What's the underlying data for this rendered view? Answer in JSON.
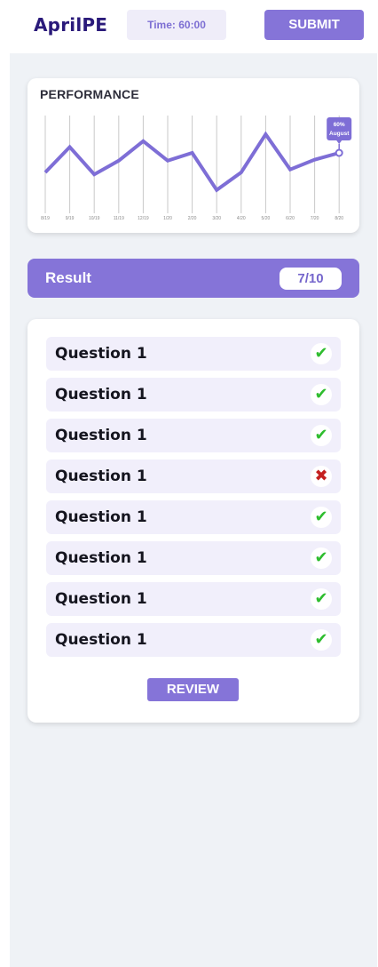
{
  "header": {
    "logo": "AprilPE",
    "timer": "Time: 60:00",
    "submit_label": "SUBMIT"
  },
  "performance": {
    "title": "PERFORMANCE"
  },
  "chart_data": {
    "type": "line",
    "title": "PERFORMANCE",
    "categories": [
      "8/19",
      "9/19",
      "10/19",
      "11/19",
      "12/19",
      "1/20",
      "2/20",
      "3/20",
      "4/20",
      "5/20",
      "6/20",
      "7/20",
      "8/20"
    ],
    "values": [
      40,
      66,
      38,
      52,
      72,
      52,
      60,
      22,
      40,
      79,
      43,
      53,
      60
    ],
    "ylim": [
      0,
      100
    ],
    "grid": "vertical",
    "color": "#7e6ed6",
    "tooltip": {
      "value": "60%",
      "label": "August"
    }
  },
  "result": {
    "label": "Result",
    "score": "7/10"
  },
  "questions": [
    {
      "label": "Question 1",
      "icon": "check-icon",
      "symbol": "✔",
      "color": "#2ebd2e"
    },
    {
      "label": "Question 1",
      "icon": "check-icon",
      "symbol": "✔",
      "color": "#2ebd2e"
    },
    {
      "label": "Question 1",
      "icon": "check-icon",
      "symbol": "✔",
      "color": "#2ebd2e"
    },
    {
      "label": "Question 1",
      "icon": "cross-icon",
      "symbol": "✖",
      "color": "#c42020"
    },
    {
      "label": "Question 1",
      "icon": "check-icon",
      "symbol": "✔",
      "color": "#2ebd2e"
    },
    {
      "label": "Question 1",
      "icon": "check-icon",
      "symbol": "✔",
      "color": "#2ebd2e"
    },
    {
      "label": "Question 1",
      "icon": "check-icon",
      "symbol": "✔",
      "color": "#2ebd2e"
    },
    {
      "label": "Question 1",
      "icon": "check-icon",
      "symbol": "✔",
      "color": "#2ebd2e"
    }
  ],
  "review_label": "REVIEW"
}
